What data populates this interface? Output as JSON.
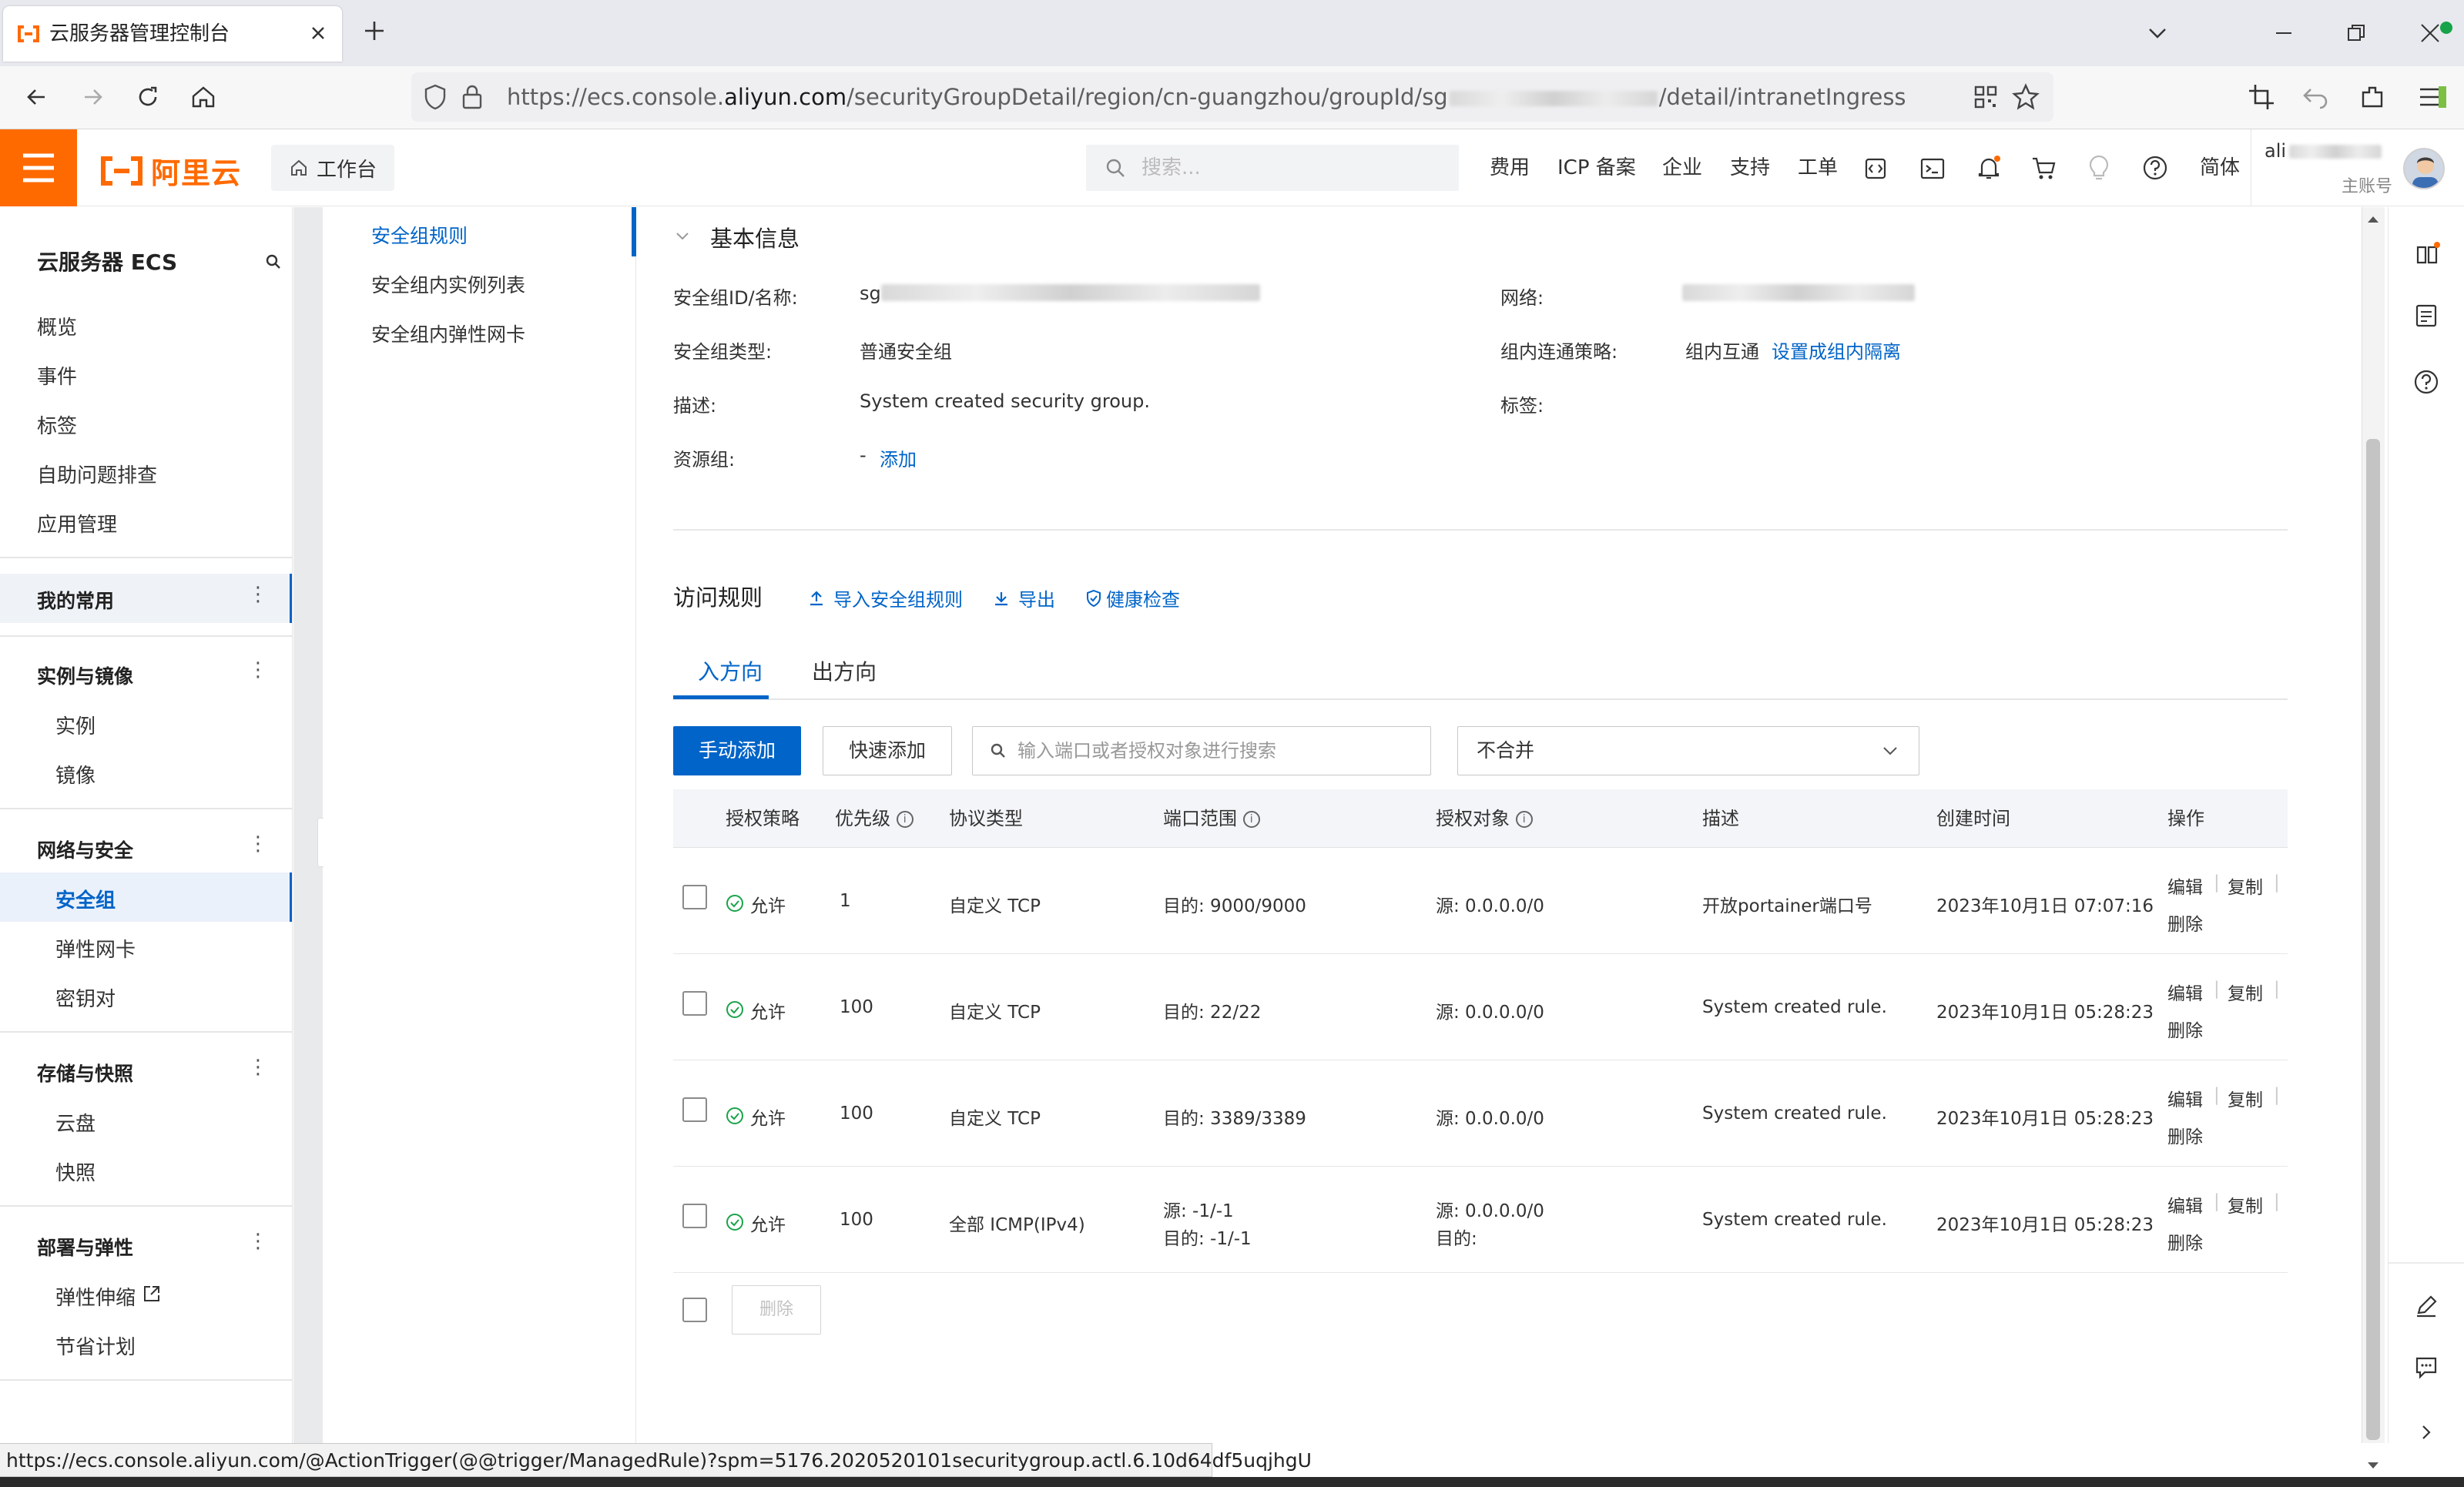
{
  "browser": {
    "tab_title": "云服务器管理控制台",
    "url_prefix": "https://ecs.console.",
    "url_domain": "aliyun.com",
    "url_path_a": "/securityGroupDetail/region/cn-guangzhou/groupId/sg",
    "url_path_b": "/detail/intranetIngress"
  },
  "header": {
    "brand": "阿里云",
    "workbench": "工作台",
    "search_placeholder": "搜索...",
    "links": [
      "费用",
      "ICP 备案",
      "企业",
      "支持",
      "工单"
    ],
    "lang": "简体",
    "account": "ali",
    "account_type": "主账号",
    "brand_color": "#ff6a00"
  },
  "sidebar": {
    "title": "云服务器 ECS",
    "top_items": [
      "概览",
      "事件",
      "标签",
      "自助问题排查",
      "应用管理"
    ],
    "favorites": "我的常用",
    "groups": [
      {
        "label": "实例与镜像",
        "items": [
          "实例",
          "镜像"
        ]
      },
      {
        "label": "网络与安全",
        "items": [
          "安全组",
          "弹性网卡",
          "密钥对"
        ]
      },
      {
        "label": "存储与快照",
        "items": [
          "云盘",
          "快照"
        ]
      },
      {
        "label": "部署与弹性",
        "items": [
          "弹性伸缩",
          "节省计划"
        ]
      }
    ],
    "active_item": "安全组"
  },
  "subnav": {
    "items": [
      "安全组规则",
      "安全组内实例列表",
      "安全组内弹性网卡"
    ],
    "active": "安全组规则"
  },
  "basic_info": {
    "title": "基本信息",
    "id_label": "安全组ID/名称:",
    "id_value": "sg",
    "network_label": "网络:",
    "type_label": "安全组类型:",
    "type_value": "普通安全组",
    "policy_label": "组内连通策略:",
    "policy_value": "组内互通",
    "policy_link": "设置成组内隔离",
    "desc_label": "描述:",
    "desc_value": "System created security group.",
    "tags_label": "标签:",
    "rg_label": "资源组:",
    "rg_value": "-",
    "rg_link": "添加"
  },
  "rules": {
    "title": "访问规则",
    "actions": [
      "导入安全组规则",
      "导出",
      "健康检查"
    ],
    "tabs": [
      "入方向",
      "出方向"
    ],
    "active_tab": "入方向",
    "add_button": "手动添加",
    "quick_button": "快速添加",
    "search_placeholder": "输入端口或者授权对象进行搜索",
    "merge_select": "不合并",
    "columns": [
      "授权策略",
      "优先级",
      "协议类型",
      "端口范围",
      "授权对象",
      "描述",
      "创建时间",
      "操作"
    ],
    "rows": [
      {
        "policy": "允许",
        "priority": "1",
        "protocol": "自定义 TCP",
        "port": "目的: 9000/9000",
        "port2": "",
        "object": "源: 0.0.0.0/0",
        "object2": "",
        "desc": "开放portainer端口号",
        "time": "2023年10月1日 07:07:16"
      },
      {
        "policy": "允许",
        "priority": "100",
        "protocol": "自定义 TCP",
        "port": "目的: 22/22",
        "port2": "",
        "object": "源: 0.0.0.0/0",
        "object2": "",
        "desc": "System created rule.",
        "time": "2023年10月1日 05:28:23"
      },
      {
        "policy": "允许",
        "priority": "100",
        "protocol": "自定义 TCP",
        "port": "目的: 3389/3389",
        "port2": "",
        "object": "源: 0.0.0.0/0",
        "object2": "",
        "desc": "System created rule.",
        "time": "2023年10月1日 05:28:23"
      },
      {
        "policy": "允许",
        "priority": "100",
        "protocol": "全部 ICMP(IPv4)",
        "port": "源: -1/-1",
        "port2": "目的: -1/-1",
        "object": "源: 0.0.0.0/0",
        "object2": "目的:",
        "desc": "System created rule.",
        "time": "2023年10月1日 05:28:23"
      }
    ],
    "row_actions": [
      "编辑",
      "复制",
      "删除"
    ],
    "bulk_delete": "删除"
  },
  "status_url": "https://ecs.console.aliyun.com/@ActionTrigger(@@trigger/ManagedRule)?spm=5176.2020520101securitygroup.actl.6.10d64df5uqjhgU"
}
